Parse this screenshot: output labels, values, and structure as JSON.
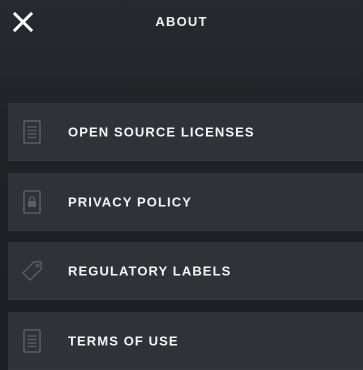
{
  "header": {
    "title": "ABOUT",
    "close_icon": "close-icon"
  },
  "menu": {
    "items": [
      {
        "label": "OPEN SOURCE LICENSES",
        "icon": "document-icon"
      },
      {
        "label": "PRIVACY POLICY",
        "icon": "lock-icon"
      },
      {
        "label": "REGULATORY LABELS",
        "icon": "tag-icon"
      },
      {
        "label": "TERMS OF USE",
        "icon": "document-icon"
      }
    ]
  },
  "colors": {
    "background": "#1f2225",
    "row": "#2f3237",
    "icon": "#5b5f65",
    "text": "#f5f5f5"
  }
}
